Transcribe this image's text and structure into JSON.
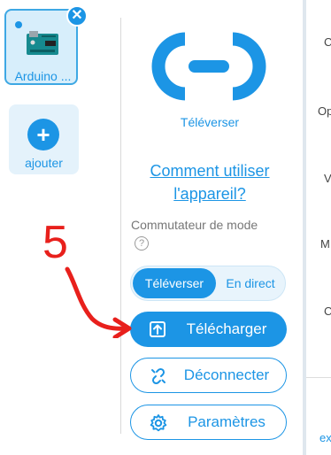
{
  "device": {
    "name": "Arduino ...",
    "close_symbol": "✕",
    "icon": "arduino-board-icon"
  },
  "add_device": {
    "label": "ajouter",
    "symbol": "+"
  },
  "upload_panel": {
    "mode_title": "Téléverser",
    "help_link": "Comment utiliser l'appareil?",
    "mode_switch_label": "Commutateur de mode",
    "help_symbol": "?",
    "toggle": {
      "upload": "Téléverser",
      "live": "En direct"
    },
    "buttons": {
      "download": "Télécharger",
      "disconnect": "Déconnecter",
      "settings": "Paramètres"
    }
  },
  "annotation": {
    "step_number": "5"
  },
  "right_panel_fragments": [
    "C",
    "Op",
    "V",
    "M",
    "C"
  ],
  "right_panel_bottom": "ex",
  "colors": {
    "accent": "#1c95e5",
    "annotation_red": "#e8201c"
  }
}
